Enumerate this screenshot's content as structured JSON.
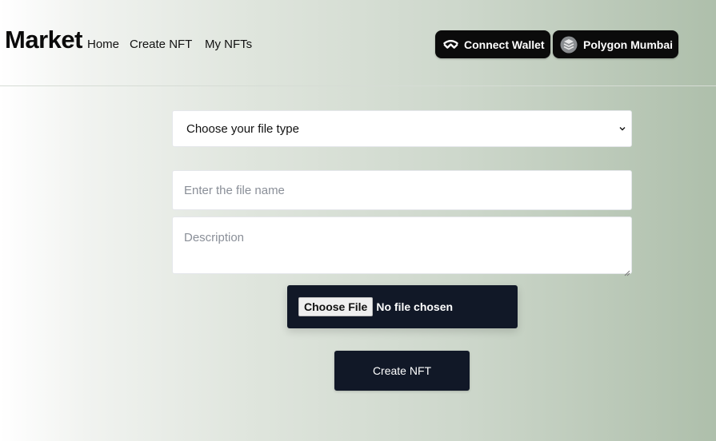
{
  "header": {
    "logo": "Market",
    "nav": {
      "home": "Home",
      "create_nft": "Create NFT",
      "my_nfts": "My NFTs"
    },
    "wallet_button": {
      "label": "Connect Wallet",
      "icon": "walletconnect-icon"
    },
    "network_button": {
      "label": "Polygon Mumbai",
      "icon": "polygon-layers-icon"
    }
  },
  "form": {
    "file_type_select": {
      "selected": "Choose your file type",
      "icon": "chevron-down-icon"
    },
    "file_name_input": {
      "placeholder": "Enter the file name",
      "value": ""
    },
    "description_input": {
      "placeholder": "Description",
      "value": ""
    },
    "file_picker": {
      "button_label": "Choose File",
      "status": "No file chosen"
    },
    "submit_label": "Create NFT"
  },
  "colors": {
    "dark_button": "#111827",
    "pill_background": "#0b0b0b",
    "gradient_left": "#ffffff",
    "gradient_right": "#aebfab"
  }
}
